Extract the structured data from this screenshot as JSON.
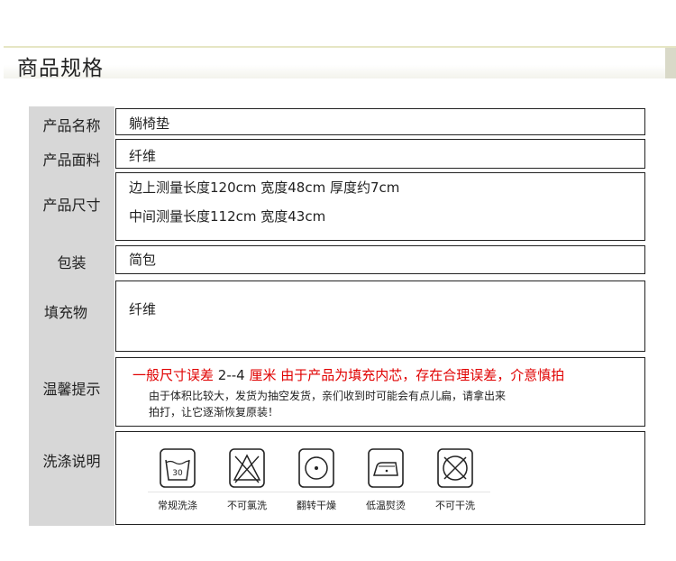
{
  "header": {
    "title": "商品规格"
  },
  "rows": [
    {
      "label": "产品名称",
      "value": "躺椅垫"
    },
    {
      "label": "产品面料",
      "value": "纤维"
    },
    {
      "label": "产品尺寸",
      "lines": [
        "边上测量长度120cm 宽度48cm 厚度约7cm",
        "中间测量长度112cm 宽度43cm"
      ]
    },
    {
      "label": "包装",
      "value": "简包"
    },
    {
      "label": "填充物",
      "value": "纤维"
    },
    {
      "label": "温馨提示",
      "notice": {
        "red_a": "一般尺寸误差",
        "middle": " 2--4 ",
        "red_b": "厘米 由于产品为填充内芯，存在合理误差，介意慎拍",
        "line2": "由于体积比较大，发货为抽空发货，亲们收到时可能会有点儿扁，请拿出来",
        "line3": "拍打，让它逐渐恢复原装！"
      }
    },
    {
      "label": "洗涤说明"
    }
  ],
  "care": [
    {
      "icon": "wash-tub-icon",
      "label": "常规洗涤",
      "temp": "30"
    },
    {
      "icon": "no-bleach-icon",
      "label": "不可氯洗"
    },
    {
      "icon": "tumble-dry-icon",
      "label": "翻转干燥"
    },
    {
      "icon": "low-iron-icon",
      "label": "低温熨烫"
    },
    {
      "icon": "no-dry-clean-icon",
      "label": "不可干洗"
    }
  ]
}
